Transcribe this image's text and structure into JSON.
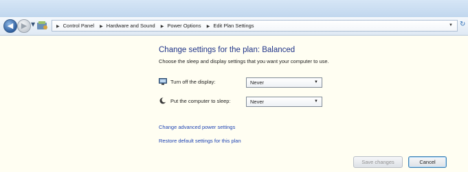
{
  "address_bar": {
    "breadcrumbs": [
      {
        "label": "Control Panel"
      },
      {
        "label": "Hardware and Sound"
      },
      {
        "label": "Power Options"
      },
      {
        "label": "Edit Plan Settings"
      }
    ]
  },
  "main": {
    "title": "Change settings for the plan: Balanced",
    "subtitle": "Choose the sleep and display settings that you want your computer to use.",
    "settings": [
      {
        "label": "Turn off the display:",
        "value": "Never",
        "icon": "display-icon"
      },
      {
        "label": "Put the computer to sleep:",
        "value": "Never",
        "icon": "moon-icon"
      }
    ],
    "links": [
      {
        "label": "Change advanced power settings"
      },
      {
        "label": "Restore default settings for this plan"
      }
    ]
  },
  "buttons": {
    "save_label": "Save changes",
    "cancel_label": "Cancel"
  },
  "colors": {
    "content_background": "#fffef2",
    "title": "#1e3287",
    "link": "#1f44b3"
  }
}
